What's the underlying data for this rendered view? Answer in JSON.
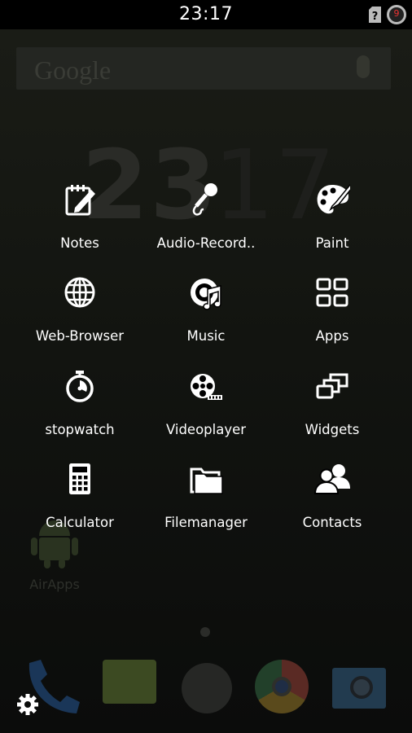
{
  "status_bar": {
    "time": "23:17",
    "notification_count": "9",
    "sim_icon": "sim-unknown-icon"
  },
  "home_background": {
    "search_brand": "Google",
    "big_clock_hours": "23",
    "big_clock_minutes": "17",
    "airapps_label": "AirApps"
  },
  "apps": [
    {
      "label": "Notes",
      "icon": "notes-icon"
    },
    {
      "label": "Audio-Record..",
      "icon": "microphone-icon"
    },
    {
      "label": "Paint",
      "icon": "paint-palette-icon"
    },
    {
      "label": "Web-Browser",
      "icon": "globe-icon"
    },
    {
      "label": "Music",
      "icon": "music-icon"
    },
    {
      "label": "Apps",
      "icon": "apps-grid-icon"
    },
    {
      "label": "stopwatch",
      "icon": "stopwatch-icon"
    },
    {
      "label": "Videoplayer",
      "icon": "film-reel-icon"
    },
    {
      "label": "Widgets",
      "icon": "widgets-icon"
    },
    {
      "label": "Calculator",
      "icon": "calculator-icon"
    },
    {
      "label": "Filemanager",
      "icon": "folder-icon"
    },
    {
      "label": "Contacts",
      "icon": "contacts-icon"
    }
  ],
  "dock": [
    "phone-icon",
    "messaging-icon",
    "app-drawer-icon",
    "chrome-icon",
    "camera-icon"
  ],
  "settings_icon": "gear-icon",
  "colors": {
    "status_bar": "#000000",
    "icon": "#ffffff",
    "background": "#0b0c0b"
  }
}
